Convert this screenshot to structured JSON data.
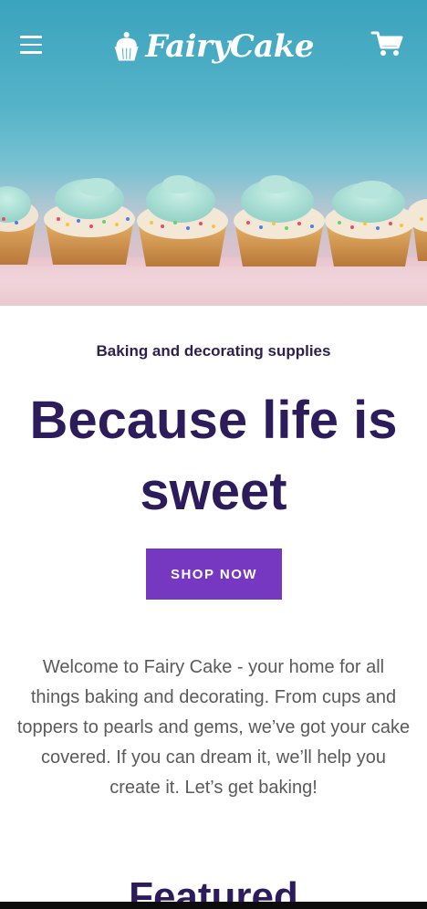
{
  "header": {
    "menu_icon": "hamburger-menu-icon",
    "logo_icon": "cupcake-icon",
    "logo_text": "FairyCake",
    "cart_icon": "shopping-cart-icon"
  },
  "hero": {
    "image_alt": "Row of cupcakes with blue frosting and sprinkles"
  },
  "main": {
    "eyebrow": "Baking and decorating supplies",
    "headline": "Because life is sweet",
    "cta_label": "SHOP NOW",
    "intro": "Welcome to Fairy Cake - your home for all things baking and decorating. From cups and toppers to pearls and gems, we’ve got your cake covered. If you can dream it, we’ll help you create it. Let’s get baking!",
    "next_section_title": "Featured"
  },
  "colors": {
    "brand_purple": "#7638c0",
    "headline_navy": "#2d1c5b",
    "body_gray": "#5a5a5a",
    "hero_teal": "#55b3c8"
  }
}
